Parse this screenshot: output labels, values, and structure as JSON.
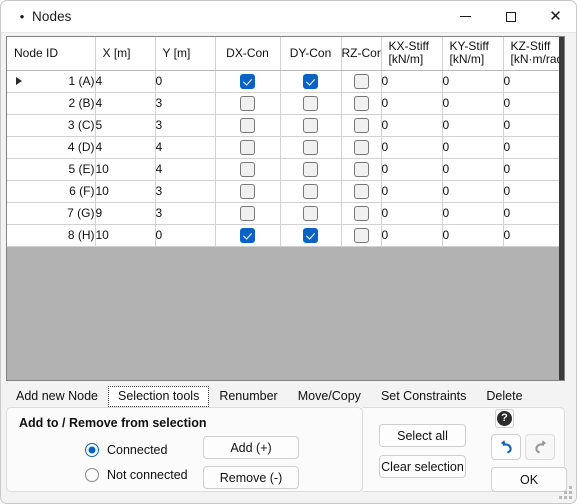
{
  "window": {
    "title": "Nodes",
    "bullet": "•",
    "minimize_label": "Minimize",
    "maximize_label": "Maximize",
    "close_label": "Close"
  },
  "table": {
    "columns": [
      {
        "id": "node_id",
        "label": "Node ID",
        "unit": ""
      },
      {
        "id": "x",
        "label": "X [m]",
        "unit": ""
      },
      {
        "id": "y",
        "label": "Y [m]",
        "unit": ""
      },
      {
        "id": "dx_con",
        "label": "DX-Con",
        "unit": ""
      },
      {
        "id": "dy_con",
        "label": "DY-Con",
        "unit": ""
      },
      {
        "id": "rz_con",
        "label": "RZ-Con",
        "unit": ""
      },
      {
        "id": "kx_stiff",
        "label": "KX-Stiff",
        "unit": "[kN/m]"
      },
      {
        "id": "ky_stiff",
        "label": "KY-Stiff",
        "unit": "[kN/m]"
      },
      {
        "id": "kz_stiff",
        "label": "KZ-Stiff",
        "unit": "[kN·m/rad]"
      }
    ],
    "rows": [
      {
        "node_id": "1 (A)",
        "x": "4",
        "y": "0",
        "dx_con": true,
        "dy_con": true,
        "rz_con": false,
        "kx_stiff": "0",
        "ky_stiff": "0",
        "kz_stiff": "0",
        "current": true,
        "x_selected": true
      },
      {
        "node_id": "2 (B)",
        "x": "4",
        "y": "3",
        "dx_con": false,
        "dy_con": false,
        "rz_con": false,
        "kx_stiff": "0",
        "ky_stiff": "0",
        "kz_stiff": "0",
        "current": false,
        "x_selected": false
      },
      {
        "node_id": "3 (C)",
        "x": "5",
        "y": "3",
        "dx_con": false,
        "dy_con": false,
        "rz_con": false,
        "kx_stiff": "0",
        "ky_stiff": "0",
        "kz_stiff": "0",
        "current": false,
        "x_selected": false
      },
      {
        "node_id": "4 (D)",
        "x": "4",
        "y": "4",
        "dx_con": false,
        "dy_con": false,
        "rz_con": false,
        "kx_stiff": "0",
        "ky_stiff": "0",
        "kz_stiff": "0",
        "current": false,
        "x_selected": false
      },
      {
        "node_id": "5 (E)",
        "x": "10",
        "y": "4",
        "dx_con": false,
        "dy_con": false,
        "rz_con": false,
        "kx_stiff": "0",
        "ky_stiff": "0",
        "kz_stiff": "0",
        "current": false,
        "x_selected": false
      },
      {
        "node_id": "6 (F)",
        "x": "10",
        "y": "3",
        "dx_con": false,
        "dy_con": false,
        "rz_con": false,
        "kx_stiff": "0",
        "ky_stiff": "0",
        "kz_stiff": "0",
        "current": false,
        "x_selected": false
      },
      {
        "node_id": "7 (G)",
        "x": "9",
        "y": "3",
        "dx_con": false,
        "dy_con": false,
        "rz_con": false,
        "kx_stiff": "0",
        "ky_stiff": "0",
        "kz_stiff": "0",
        "current": false,
        "x_selected": false
      },
      {
        "node_id": "8 (H)",
        "x": "10",
        "y": "0",
        "dx_con": true,
        "dy_con": true,
        "rz_con": false,
        "kx_stiff": "0",
        "ky_stiff": "0",
        "kz_stiff": "0",
        "current": false,
        "x_selected": false
      }
    ]
  },
  "tabs": [
    {
      "label": "Add new Node",
      "active": false
    },
    {
      "label": "Selection tools",
      "active": true
    },
    {
      "label": "Renumber",
      "active": false
    },
    {
      "label": "Move/Copy",
      "active": false
    },
    {
      "label": "Set Constraints",
      "active": false
    },
    {
      "label": "Delete",
      "active": false
    }
  ],
  "selection_panel": {
    "title": "Add to / Remove from selection",
    "radios": [
      {
        "label": "Connected",
        "selected": true
      },
      {
        "label": "Not connected",
        "selected": false
      }
    ],
    "add_label": "Add (+)",
    "remove_label": "Remove (-)"
  },
  "actions": {
    "select_all_label": "Select all",
    "clear_selection_label": "Clear selection",
    "help_label": "?",
    "undo_label": "Undo",
    "redo_label": "Redo",
    "ok_label": "OK"
  },
  "colors": {
    "accent": "#0a63c4",
    "selection": "#0a74d1",
    "empty_area": "#b1b1b1",
    "undo_enabled": "#1464b4",
    "redo_disabled": "#9a9a9a"
  }
}
